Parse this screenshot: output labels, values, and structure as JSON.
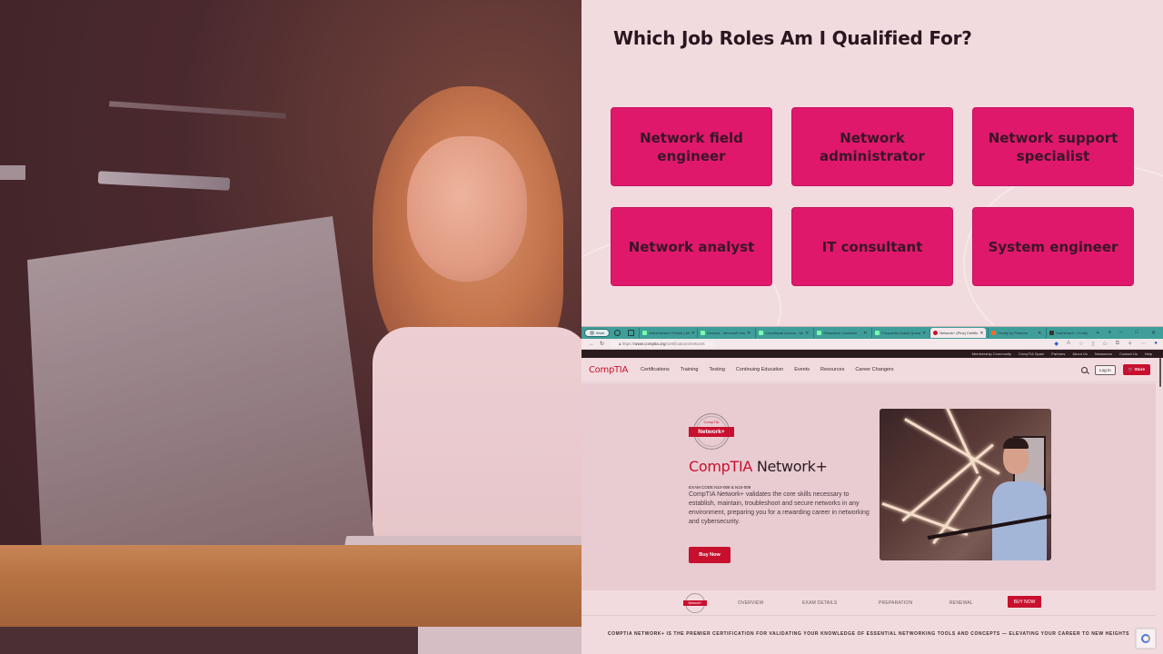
{
  "slide": {
    "heading": "Which Job Roles Am I Qualified For?",
    "accent_color": "#e0186c",
    "roles": [
      "Network field engineer",
      "Network administrator",
      "Network support specialist",
      "Network analyst",
      "IT consultant",
      "System engineer"
    ],
    "photo_alt": "Smiling woman working on a laptop at a wooden table"
  },
  "browser": {
    "profile_label": "Work",
    "tabs": [
      {
        "title": "Administrator Portals | Mi",
        "active": false
      },
      {
        "title": "Devices - Microsoft Intu",
        "active": false
      },
      {
        "title": "Conditional Access - Mi",
        "active": false
      },
      {
        "title": "Simulation Container",
        "active": false
      },
      {
        "title": "Frequently Asked Quest",
        "active": false
      },
      {
        "title": "Network+ (Plus) Certific",
        "active": true
      },
      {
        "title": "Credly by Pearson",
        "active": false
      },
      {
        "title": "Dashboard - Credly",
        "active": false
      }
    ],
    "new_tab": "+",
    "window_controls": [
      "–",
      "□",
      "✕"
    ],
    "url_prefix": "https://",
    "url_host": "www.comptia.org",
    "url_path": "/certifications/network"
  },
  "site": {
    "utility_links": [
      "Membership Community",
      "CompTIA Spark",
      "Partners",
      "About Us",
      "Newsroom",
      "Contact Us",
      "Help"
    ],
    "logo": "CompTIA",
    "brand_color": "#c8102e",
    "nav_links": [
      "Certifications",
      "Training",
      "Testing",
      "Continuing Education",
      "Events",
      "Resources",
      "Career Changers"
    ],
    "login_label": "Log In",
    "store_label": "🛒 Store",
    "badge_small": "CompTIA",
    "badge_label": "Network+",
    "hero_title_brand": "CompTIA",
    "hero_title_product": " Network+",
    "exam_code": "EXAM CODE N10-008 & N10-009",
    "description": "CompTIA Network+ validates the core skills necessary to establish, maintain, troubleshoot and secure networks in any environment, preparing you for a rewarding career in networking and cybersecurity.",
    "buy_now_label": "Buy Now",
    "subnav_links": [
      "OVERVIEW",
      "EXAM DETAILS",
      "PREPARATION",
      "RENEWAL"
    ],
    "subnav_buy_label": "BUY NOW",
    "tagline": "COMPTIA NETWORK+ IS THE PREMIER CERTIFICATION FOR VALIDATING YOUR KNOWLEDGE OF ESSENTIAL NETWORKING TOOLS AND CONCEPTS — ELEVATING YOUR CAREER TO NEW HEIGHTS"
  }
}
